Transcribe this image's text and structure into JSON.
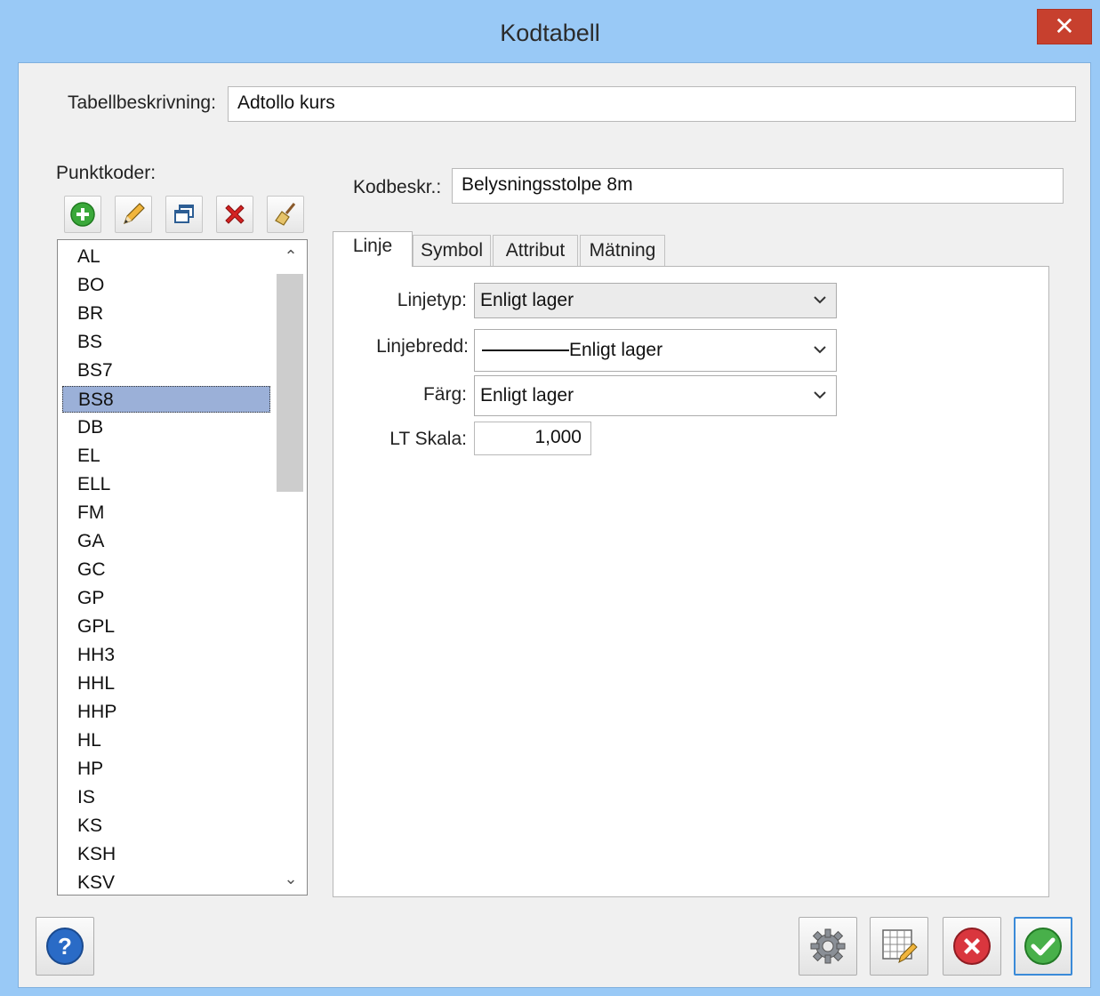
{
  "window": {
    "title": "Kodtabell",
    "close_glyph": "✕"
  },
  "table_desc": {
    "label": "Tabellbeskrivning:",
    "value": "Adtollo kurs"
  },
  "point_codes": {
    "label": "Punktkoder:",
    "toolbar": [
      "add-icon",
      "edit-icon",
      "copy-icon",
      "delete-icon",
      "clean-icon"
    ],
    "items": [
      "AL",
      "BO",
      "BR",
      "BS",
      "BS7",
      "BS8",
      "DB",
      "EL",
      "ELL",
      "FM",
      "GA",
      "GC",
      "GP",
      "GPL",
      "HH3",
      "HHL",
      "HHP",
      "HL",
      "HP",
      "IS",
      "KS",
      "KSH",
      "KSV"
    ],
    "selected": "BS8",
    "scroll_up": "⌃",
    "scroll_down": "⌄"
  },
  "code_desc": {
    "label": "Kodbeskr.:",
    "value": "Belysningsstolpe 8m"
  },
  "tabs": [
    "Linje",
    "Symbol",
    "Attribut",
    "Mätning"
  ],
  "active_tab": "Linje",
  "line": {
    "linetype_label": "Linjetyp:",
    "linetype_value": "Enligt lager",
    "linewidth_label": "Linjebredd:",
    "linewidth_value": "Enligt lager",
    "color_label": "Färg:",
    "color_value": "Enligt lager",
    "ltscale_label": "LT Skala:",
    "ltscale_value": "1,000"
  },
  "buttons": [
    "help-icon",
    "settings-icon",
    "table-edit-icon",
    "cancel-icon",
    "ok-icon"
  ],
  "colors": {
    "titlebar": "#99c9f6",
    "close": "#c7402e",
    "selection": "#9bb0d8"
  }
}
